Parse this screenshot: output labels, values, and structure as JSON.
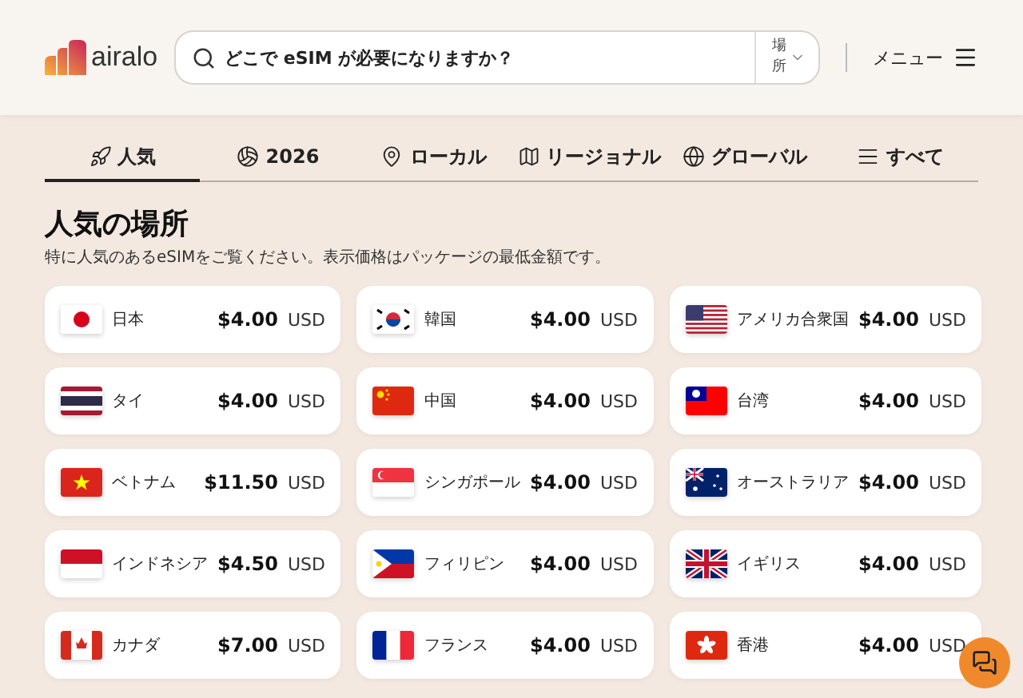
{
  "header": {
    "logo": "airalo",
    "search": {
      "placeholder": "どこで eSIM が必要になりますか？"
    },
    "location_button": "場所",
    "menu_button": "メニュー"
  },
  "tabs": [
    {
      "label": "人気",
      "selected": true
    },
    {
      "label": "2026",
      "selected": false
    },
    {
      "label": "ローカル",
      "selected": false
    },
    {
      "label": "リージョナル",
      "selected": false
    },
    {
      "label": "グローバル",
      "selected": false
    },
    {
      "label": "すべて",
      "selected": false
    }
  ],
  "section": {
    "title": "人気の場所",
    "subtitle": "特に人気のあるeSIMをご覧ください。表示価格はパッケージの最低金額です。"
  },
  "destinations": [
    {
      "name": "日本",
      "price": "$4.00",
      "currency": "USD"
    },
    {
      "name": "韓国",
      "price": "$4.00",
      "currency": "USD"
    },
    {
      "name": "アメリカ合衆国",
      "price": "$4.00",
      "currency": "USD"
    },
    {
      "name": "タイ",
      "price": "$4.00",
      "currency": "USD"
    },
    {
      "name": "中国",
      "price": "$4.00",
      "currency": "USD"
    },
    {
      "name": "台湾",
      "price": "$4.00",
      "currency": "USD"
    },
    {
      "name": "ベトナム",
      "price": "$11.50",
      "currency": "USD"
    },
    {
      "name": "シンガポール",
      "price": "$4.00",
      "currency": "USD"
    },
    {
      "name": "オーストラリア",
      "price": "$4.00",
      "currency": "USD"
    },
    {
      "name": "インドネシア",
      "price": "$4.50",
      "currency": "USD"
    },
    {
      "name": "フィリピン",
      "price": "$4.00",
      "currency": "USD"
    },
    {
      "name": "イギリス",
      "price": "$4.00",
      "currency": "USD"
    },
    {
      "name": "カナダ",
      "price": "$7.00",
      "currency": "USD"
    },
    {
      "name": "フランス",
      "price": "$4.00",
      "currency": "USD"
    },
    {
      "name": "香港",
      "price": "$4.00",
      "currency": "USD"
    }
  ]
}
